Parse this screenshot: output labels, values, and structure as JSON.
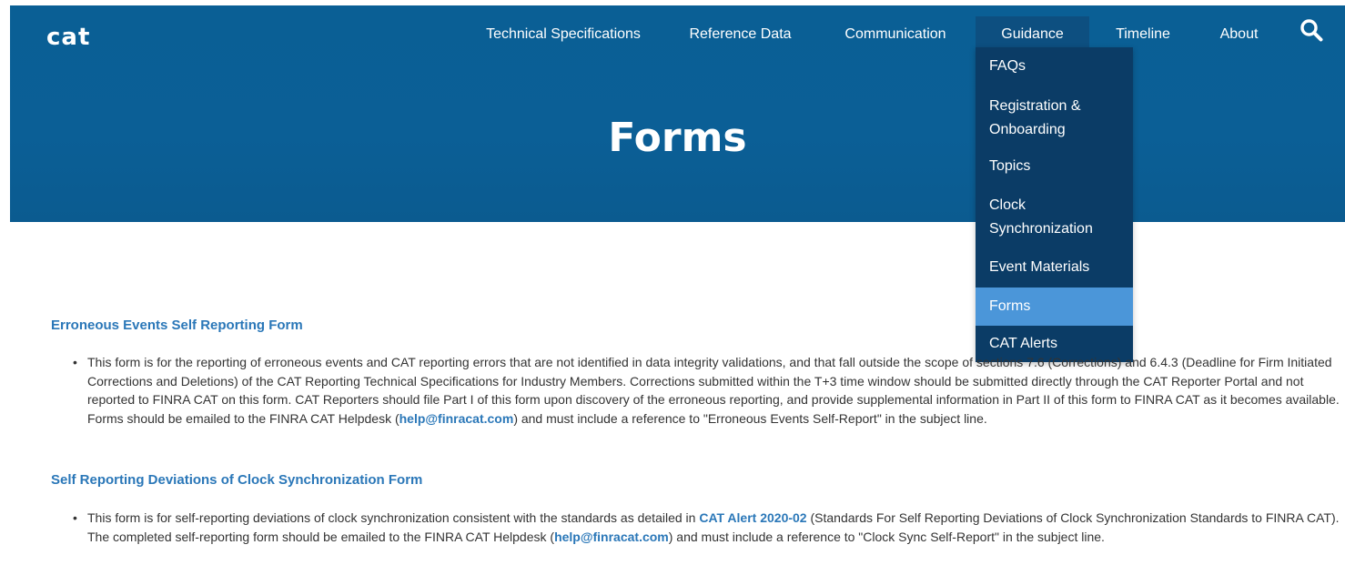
{
  "header": {
    "logo": "cat",
    "nav": [
      {
        "label": "Technical Specifications",
        "active": false
      },
      {
        "label": "Reference Data",
        "active": false
      },
      {
        "label": "Communication",
        "active": false
      },
      {
        "label": "Guidance",
        "active": true
      },
      {
        "label": "Timeline",
        "active": false
      },
      {
        "label": "About",
        "active": false
      }
    ],
    "search_icon": "search-icon"
  },
  "hero": {
    "title": "Forms"
  },
  "dropdown": {
    "items": [
      {
        "label": "FAQs"
      },
      {
        "label": "Registration & Onboarding"
      },
      {
        "label": "Topics"
      },
      {
        "label": "Clock Synchronization"
      },
      {
        "label": "Event Materials"
      },
      {
        "label": "Forms",
        "active": true
      },
      {
        "label": "CAT Alerts"
      }
    ]
  },
  "sections": [
    {
      "title": "Erroneous Events Self Reporting Form",
      "text_1": "This form is for the reporting of erroneous events and CAT reporting errors that are not identified in data integrity validations, and that fall outside the scope of sections 7.6 (Corrections) and 6.4.3 (Deadline for Firm Initiated Corrections and Deletions) of the CAT Reporting Technical Specifications for Industry Members. Corrections submitted within the T+3 time window should be submitted directly through the CAT Reporter Portal and not reported to FINRA CAT on this form. CAT Reporters should file Part I of this form upon discovery of the erroneous reporting, and provide supplemental information in Part II of this form to FINRA CAT as it becomes available. Forms should be emailed to the FINRA CAT Helpdesk (",
      "link_1": "help@finracat.com",
      "text_2": ") and must include a reference to \"Erroneous Events Self-Report\" in the subject line."
    },
    {
      "title": "Self Reporting Deviations of Clock Synchronization Form",
      "text_1": "This form is for self-reporting deviations of clock synchronization consistent with the standards as detailed in ",
      "link_1": "CAT Alert 2020-02",
      "text_2": " (Standards For Self Reporting Deviations of Clock Synchronization Standards to FINRA CAT). The completed self-reporting form should be emailed to the FINRA CAT Helpdesk (",
      "link_2": "help@finracat.com",
      "text_3": ") and must include a reference to \"Clock Sync Self-Report\" in the subject line."
    }
  ],
  "colors": {
    "hero": "#0b5f96",
    "dropdown": "#0b3c66",
    "dropdown_active": "#4b96d9",
    "link": "#2a77b8"
  }
}
